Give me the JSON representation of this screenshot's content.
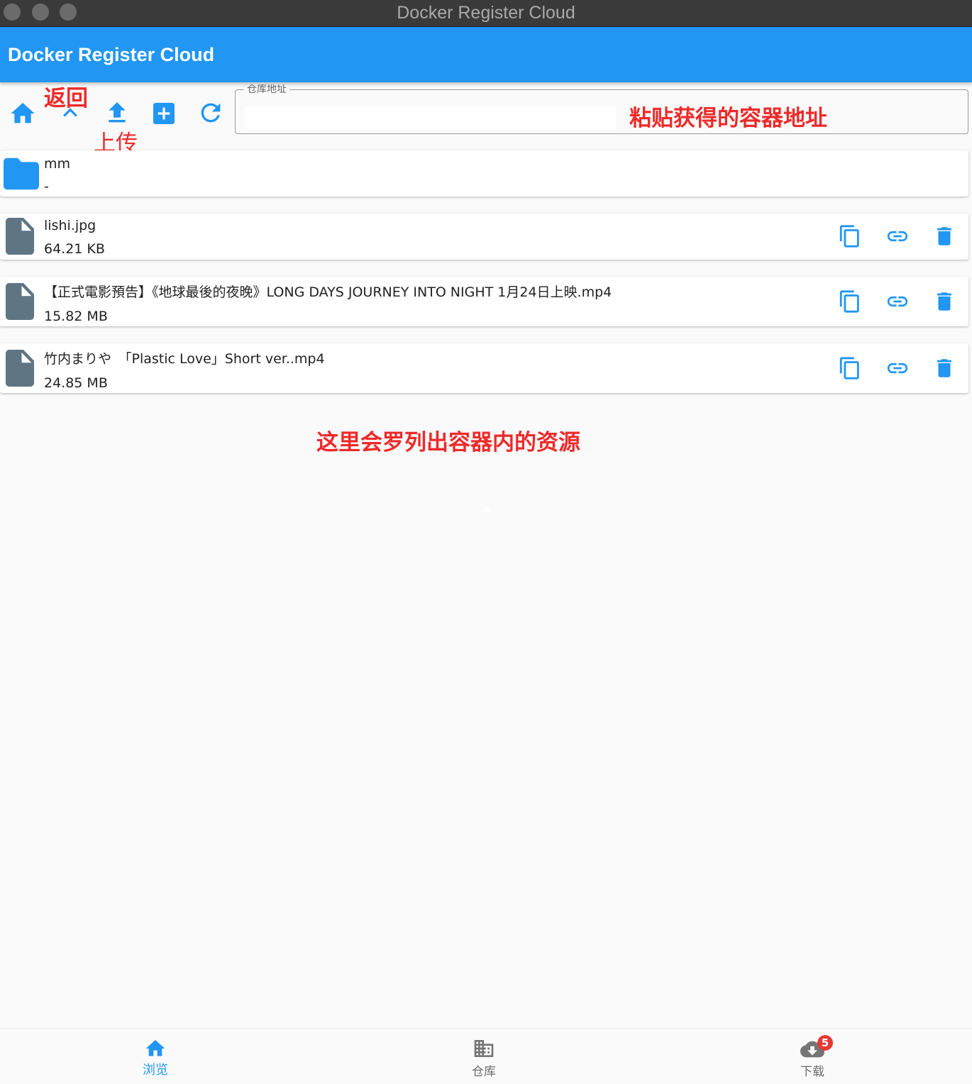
{
  "window": {
    "title": "Docker Register Cloud"
  },
  "appbar": {
    "title": "Docker Register Cloud"
  },
  "toolbar": {
    "home_icon": "home-icon",
    "up_icon": "chevron-up-icon",
    "upload_icon": "upload-icon",
    "new_folder_icon": "add-box-icon",
    "refresh_icon": "refresh-icon",
    "address_label": "仓库地址",
    "address_value": "",
    "address_placeholder": ""
  },
  "annotations": {
    "back": "返回",
    "upload": "上传",
    "address": "粘贴获得的容器地址",
    "list": "这里会罗列出容器内的资源"
  },
  "files": [
    {
      "name": "mm",
      "size": "-",
      "type": "folder",
      "icon": "folder-icon"
    },
    {
      "name": "lishi.jpg",
      "size": "64.21 KB",
      "type": "file",
      "icon": "file-icon"
    },
    {
      "name": "【正式電影預告】《地球最後的夜晚》LONG DAYS JOURNEY INTO NIGHT 1月24日上映.mp4",
      "size": "15.82 MB",
      "type": "file",
      "icon": "file-icon"
    },
    {
      "name": "竹内まりや　「Plastic Love」Short ver..mp4",
      "size": "24.85 MB",
      "type": "file",
      "icon": "file-icon"
    }
  ],
  "file_actions": [
    "copy-icon",
    "link-icon",
    "delete-icon"
  ],
  "bottom_nav": {
    "items": [
      {
        "label": "浏览",
        "icon": "home-icon",
        "active": true
      },
      {
        "label": "仓库",
        "icon": "building-icon",
        "active": false
      },
      {
        "label": "下载",
        "icon": "cloud-download-icon",
        "active": false,
        "badge": "5"
      }
    ]
  },
  "colors": {
    "primary": "#2196f3",
    "file_icon": "#5f7584",
    "annotation": "#ee2a2a",
    "badge": "#e53935"
  }
}
